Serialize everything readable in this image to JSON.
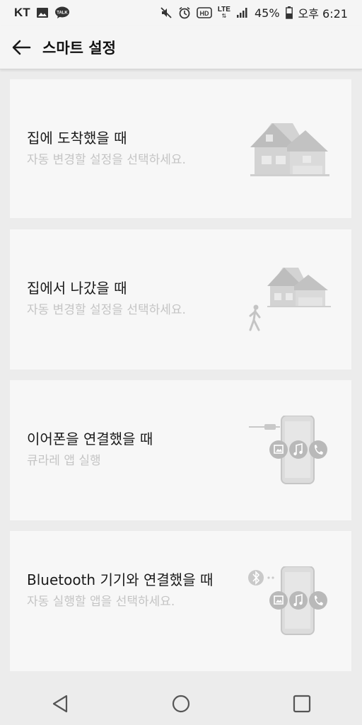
{
  "status_bar": {
    "carrier": "KT",
    "lte": "LTE",
    "hd": "HD",
    "battery": "45%",
    "time": "오후 6:21",
    "icons": [
      "gallery-icon",
      "talk-icon",
      "mute-icon",
      "alarm-icon",
      "hd-icon",
      "lte-icon",
      "signal-icon",
      "battery-icon"
    ]
  },
  "app_bar": {
    "title": "스마트 설정",
    "back_icon": "arrow-left-icon"
  },
  "cards": [
    {
      "title": "집에 도착했을 때",
      "subtitle": "자동 변경할 설정을 선택하세요.",
      "illustration": "house-icon"
    },
    {
      "title": "집에서 나갔을 때",
      "subtitle": "자동 변경할 설정을 선택하세요.",
      "illustration": "house-walking-person-icon"
    },
    {
      "title": "이어폰을 연결했을 때",
      "subtitle": "큐라레 앱 실행",
      "illustration": "earphone-phone-icon"
    },
    {
      "title": "Bluetooth 기기와 연결했을 때",
      "subtitle": "자동 실행할 앱을 선택하세요.",
      "illustration": "bluetooth-phone-icon"
    }
  ],
  "nav_bar": {
    "icons": [
      "back-triangle-icon",
      "home-circle-icon",
      "recents-square-icon"
    ]
  },
  "colors": {
    "card_bg": "#f7f7f7",
    "page_bg": "#ececec",
    "subtitle": "#c4c4c4",
    "illustration": "#c9c9c9"
  }
}
